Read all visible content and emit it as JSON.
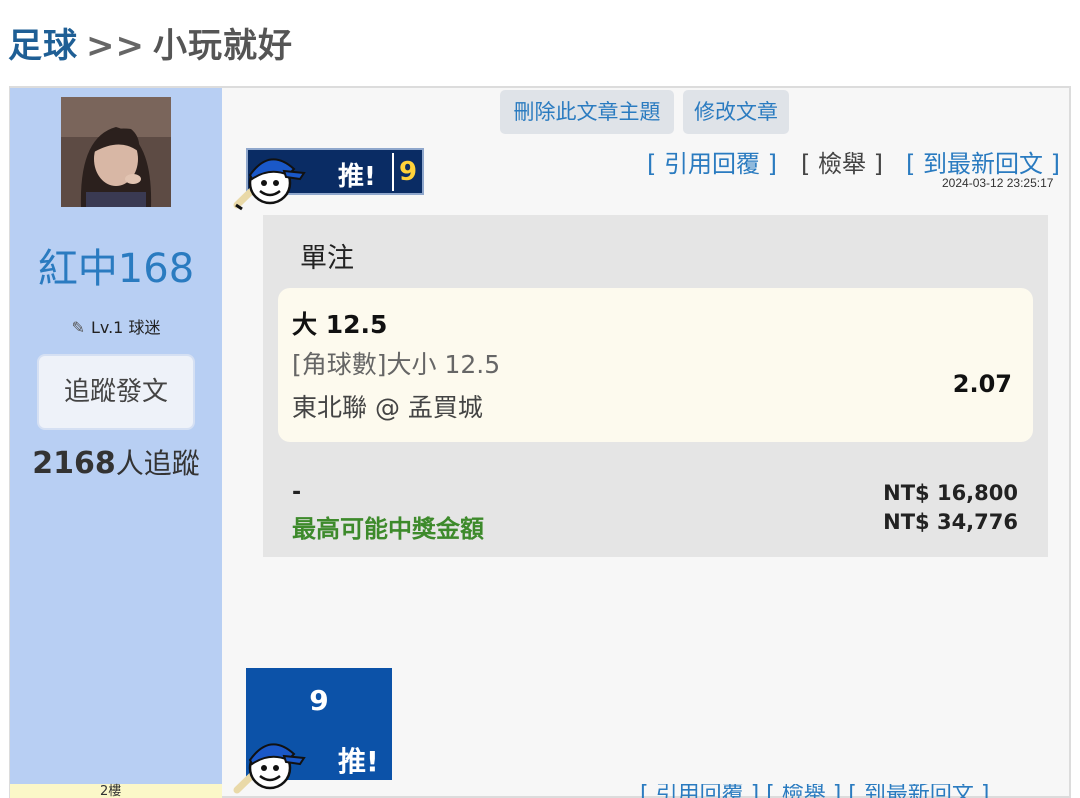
{
  "header": {
    "board": "足球",
    "separator": ">>",
    "title": "小玩就好"
  },
  "user": {
    "name": "紅中168",
    "level": "Lv.1 球迷",
    "follow_button": "追蹤發文",
    "followers_count": "2168",
    "followers_suffix": "人追蹤"
  },
  "toolbar": {
    "delete_topic": "刪除此文章主題",
    "edit_post": "修改文章"
  },
  "post": {
    "push_label": "推!",
    "push_count": "9",
    "actions": {
      "quote": "[ 引用回覆 ]",
      "report": "[ 檢舉 ]",
      "latest": "[ 到最新回文 ]"
    },
    "timestamp": "2024-03-12 23:25:17"
  },
  "bet": {
    "type": "單注",
    "pick": "大 12.5",
    "market": "[角球數]大小 12.5",
    "match": "東北聯 @ 孟買城",
    "odds": "2.07",
    "stake_label": "-",
    "stake_amount": "NT$ 16,800",
    "max_label": "最高可能中獎金額",
    "max_amount": "NT$ 34,776"
  },
  "vote": {
    "count": "9",
    "label": "推!"
  },
  "next_floor": {
    "label": "2樓",
    "actions": "[ 引用回覆 ] [ 檢舉 ] [ 到最新回文 ]"
  },
  "colors": {
    "sidebar": "#b8cff3",
    "link": "#2a7bc0",
    "badge_navy": "#0a2c64",
    "vote_blue": "#0c52a8",
    "win_green": "#3d8a2b",
    "count_yellow": "#ffd23a"
  },
  "icons": {
    "mascot": "baseball-mascot-icon",
    "pencil": "pencil-icon"
  }
}
